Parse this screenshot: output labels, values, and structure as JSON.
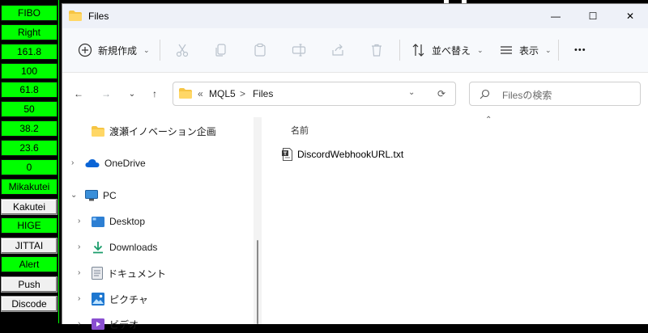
{
  "left_panel": {
    "buttons": [
      {
        "label": "FIBO",
        "style": "green"
      },
      {
        "label": "Right",
        "style": "green"
      },
      {
        "label": "161.8",
        "style": "green"
      },
      {
        "label": "100",
        "style": "green"
      },
      {
        "label": "61.8",
        "style": "green"
      },
      {
        "label": "50",
        "style": "green"
      },
      {
        "label": "38.2",
        "style": "green"
      },
      {
        "label": "23.6",
        "style": "green"
      },
      {
        "label": "0",
        "style": "green"
      },
      {
        "label": "Mikakutei",
        "style": "green"
      },
      {
        "label": "Kakutei",
        "style": "white"
      },
      {
        "label": "HIGE",
        "style": "green"
      },
      {
        "label": "JITTAI",
        "style": "white"
      },
      {
        "label": "Alert",
        "style": "green"
      },
      {
        "label": "Push",
        "style": "white"
      },
      {
        "label": "Discode",
        "style": "white"
      }
    ]
  },
  "window": {
    "title": "Files",
    "controls": {
      "minimize": "—",
      "maximize": "☐",
      "close": "✕"
    }
  },
  "toolbar": {
    "new_label": "新規作成",
    "sort_label": "並べ替え",
    "view_label": "表示",
    "more_label": "•••"
  },
  "nav": {
    "back": "←",
    "forward": "→",
    "recent": "⌄",
    "up": "↑",
    "breadcrumb": [
      "«",
      "MQL5",
      ">",
      "Files"
    ],
    "breadcrumb_dropdown": "⌄",
    "refresh": "⟳",
    "search_placeholder": "Filesの検索"
  },
  "sidebar": {
    "items": [
      {
        "label": "渡瀬イノベーション企画",
        "icon": "folder-icon"
      },
      {
        "label": "OneDrive",
        "icon": "cloud-icon"
      },
      {
        "label": "PC",
        "icon": "monitor-icon"
      },
      {
        "label": "Desktop",
        "icon": "desktop-icon"
      },
      {
        "label": "Downloads",
        "icon": "download-icon"
      },
      {
        "label": "ドキュメント",
        "icon": "document-icon"
      },
      {
        "label": "ピクチャ",
        "icon": "picture-icon"
      },
      {
        "label": "ビデオ",
        "icon": "video-icon"
      }
    ]
  },
  "content": {
    "column_header": "名前",
    "files": [
      {
        "name": "DiscordWebhookURL.txt",
        "icon": "text-file-icon"
      }
    ]
  },
  "colors": {
    "button_green": "#00ff00",
    "button_white": "#f0f0f0",
    "folder_yellow": "#f6c544",
    "accent_blue": "#0067c0"
  }
}
